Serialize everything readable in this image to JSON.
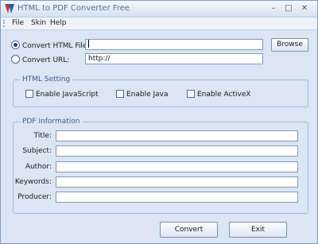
{
  "window": {
    "title": "HTML to PDF Converter Free"
  },
  "menu": [
    "File",
    "Skin",
    "Help"
  ],
  "source": {
    "html_file_label": "Convert HTML File:",
    "html_file_value": "",
    "url_label": "Convert URL:",
    "url_value": "http://",
    "browse_label": "Browse"
  },
  "html_setting": {
    "legend": "HTML Setting",
    "options": [
      "Enable JavaScript",
      "Enable Java",
      "Enable ActiveX"
    ]
  },
  "pdf_info": {
    "legend": "PDF Information",
    "fields": [
      "Title:",
      "Subject:",
      "Author:",
      "Keywords:",
      "Producer:"
    ]
  },
  "buttons": {
    "convert": "Convert",
    "exit": "Exit"
  }
}
